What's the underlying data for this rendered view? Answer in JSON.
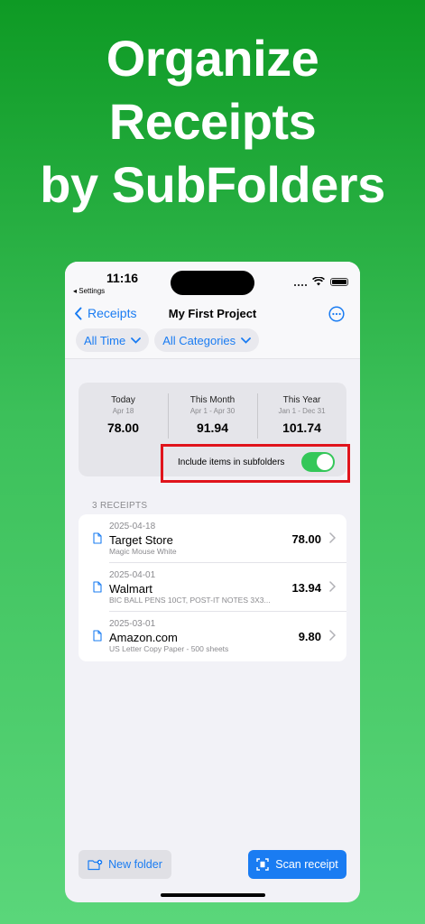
{
  "headline": [
    "Organize",
    "Receipts",
    "by SubFolders"
  ],
  "status_bar": {
    "time": "11:16",
    "back_app": "◂ Settings"
  },
  "nav": {
    "back_label": "Receipts",
    "title": "My First Project",
    "more_icon": "ellipsis-circle-icon"
  },
  "filters": [
    {
      "label": "All Time"
    },
    {
      "label": "All Categories"
    }
  ],
  "summary": {
    "today": {
      "label": "Today",
      "range": "Apr 18",
      "value": "78.00"
    },
    "month": {
      "label": "This Month",
      "range": "Apr 1 - Apr 30",
      "value": "91.94"
    },
    "year": {
      "label": "This Year",
      "range": "Jan 1 - Dec 31",
      "value": "101.74"
    },
    "toggle_label": "Include items in subfolders",
    "toggle_on": true
  },
  "receipts_header": "3 RECEIPTS",
  "receipts": [
    {
      "date": "2025-04-18",
      "name": "Target Store",
      "subtitle": "Magic Mouse White",
      "amount": "78.00"
    },
    {
      "date": "2025-04-01",
      "name": "Walmart",
      "subtitle": "BIC BALL PENS 10CT, POST-IT NOTES 3X3...",
      "amount": "13.94"
    },
    {
      "date": "2025-03-01",
      "name": "Amazon.com",
      "subtitle": "US Letter Copy Paper - 500 sheets",
      "amount": "9.80"
    }
  ],
  "buttons": {
    "new_folder": "New folder",
    "scan_receipt": "Scan receipt"
  },
  "colors": {
    "accent": "#1a7cf2",
    "toggle_on": "#34c759",
    "highlight": "#e0141c",
    "background_top": "#0e9a24"
  }
}
